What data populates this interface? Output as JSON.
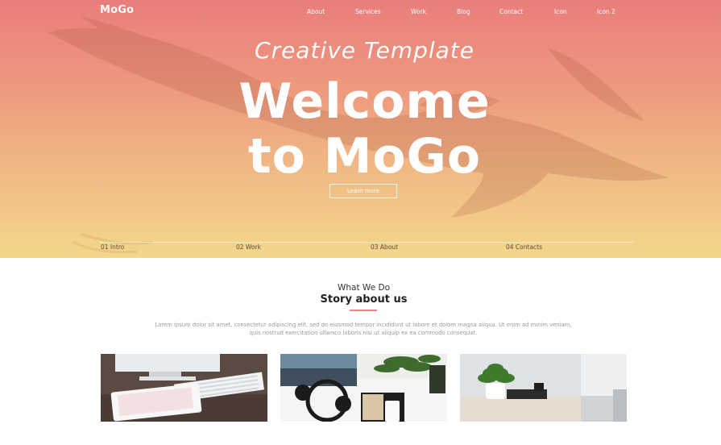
{
  "brand": {
    "logo": "MoGo"
  },
  "nav": {
    "items": [
      "About",
      "Services",
      "Work",
      "Blog",
      "Contact",
      "Icon",
      "Icon 2"
    ]
  },
  "hero": {
    "subtitle": "Creative Template",
    "headline_line1": "Welcome",
    "headline_line2": "to MoGo",
    "cta_label": "Learn more"
  },
  "steps": [
    "01 Intro",
    "02 Work",
    "03 About",
    "04 Contacts"
  ],
  "about": {
    "kicker": "What We Do",
    "title": "Story about us",
    "text": "Lorem ipsum dolor sit amet, consectetur adipiscing elit, sed do eiusmod tempor incididunt ut labore et dolore magna aliqua. Ut enim ad minim veniam, quis nostrud exercitation ullamco laboris nisi ut aliquip ex ea commodo consequat."
  },
  "photos": [
    {
      "icon": "desk-computer-tablet-photo"
    },
    {
      "icon": "headphones-notebook-plant-photo"
    },
    {
      "icon": "plant-office-desk-photo"
    }
  ],
  "colors": {
    "hero_top": "#ea7d7b",
    "hero_bottom": "#f4d78a",
    "accent": "#f38181",
    "text_muted": "#999999"
  }
}
